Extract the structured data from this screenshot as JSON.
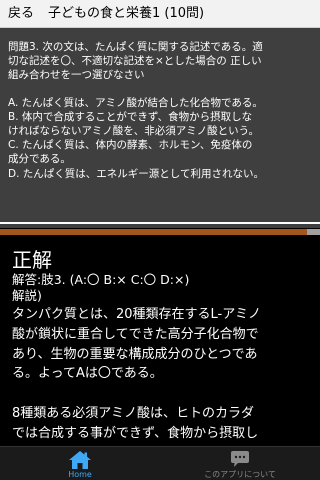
{
  "header": {
    "back_label": "戻る",
    "title": "子どもの食と栄養1 (10問)"
  },
  "question": {
    "text": "問題3. 次の文は、たんぱく質に関する記述である。適\n切な記述を〇、不適切な記述を×とした場合の 正しい\n組み合わせを一つ選びなさい",
    "options": [
      "A. たんぱく質は、アミノ酸が結合した化合物である。",
      "B. 体内で合成することができず、食物から摂取しな\nければならないアミノ酸を、非必須アミノ酸という。",
      "C. たんぱく質は、体内の酵素、ホルモン、免疫体の\n成分である。",
      "D. たんぱく質は、エネルギー源として利用されない。"
    ]
  },
  "progress": {
    "percent": 96
  },
  "answer": {
    "heading": "正解",
    "answer_line": "解答:肢3. (A:〇 B:× C:〇 D:×)",
    "explanation_label": "解説)",
    "explanation": "タンパク質とは、20種類存在するL-アミノ\n酸が鎖状に重合してできた高分子化合物で\nあり、生物の重要な構成成分のひとつであ\nる。よってAは〇である。\n\n8種類ある必須アミノ酸は、ヒトのカラダ\nでは合成する事ができず、食物から摂取し\nなければならないアミノ酸である。"
  },
  "tabs": [
    {
      "label": "Home",
      "icon": "home-icon",
      "active": true
    },
    {
      "label": "このアプリについて",
      "icon": "speech-bubble-icon",
      "active": false
    }
  ],
  "colors": {
    "question_bg": "#3f3f3f",
    "progress_fill": "#a4561a",
    "active_tab": "#3fa9f5"
  }
}
